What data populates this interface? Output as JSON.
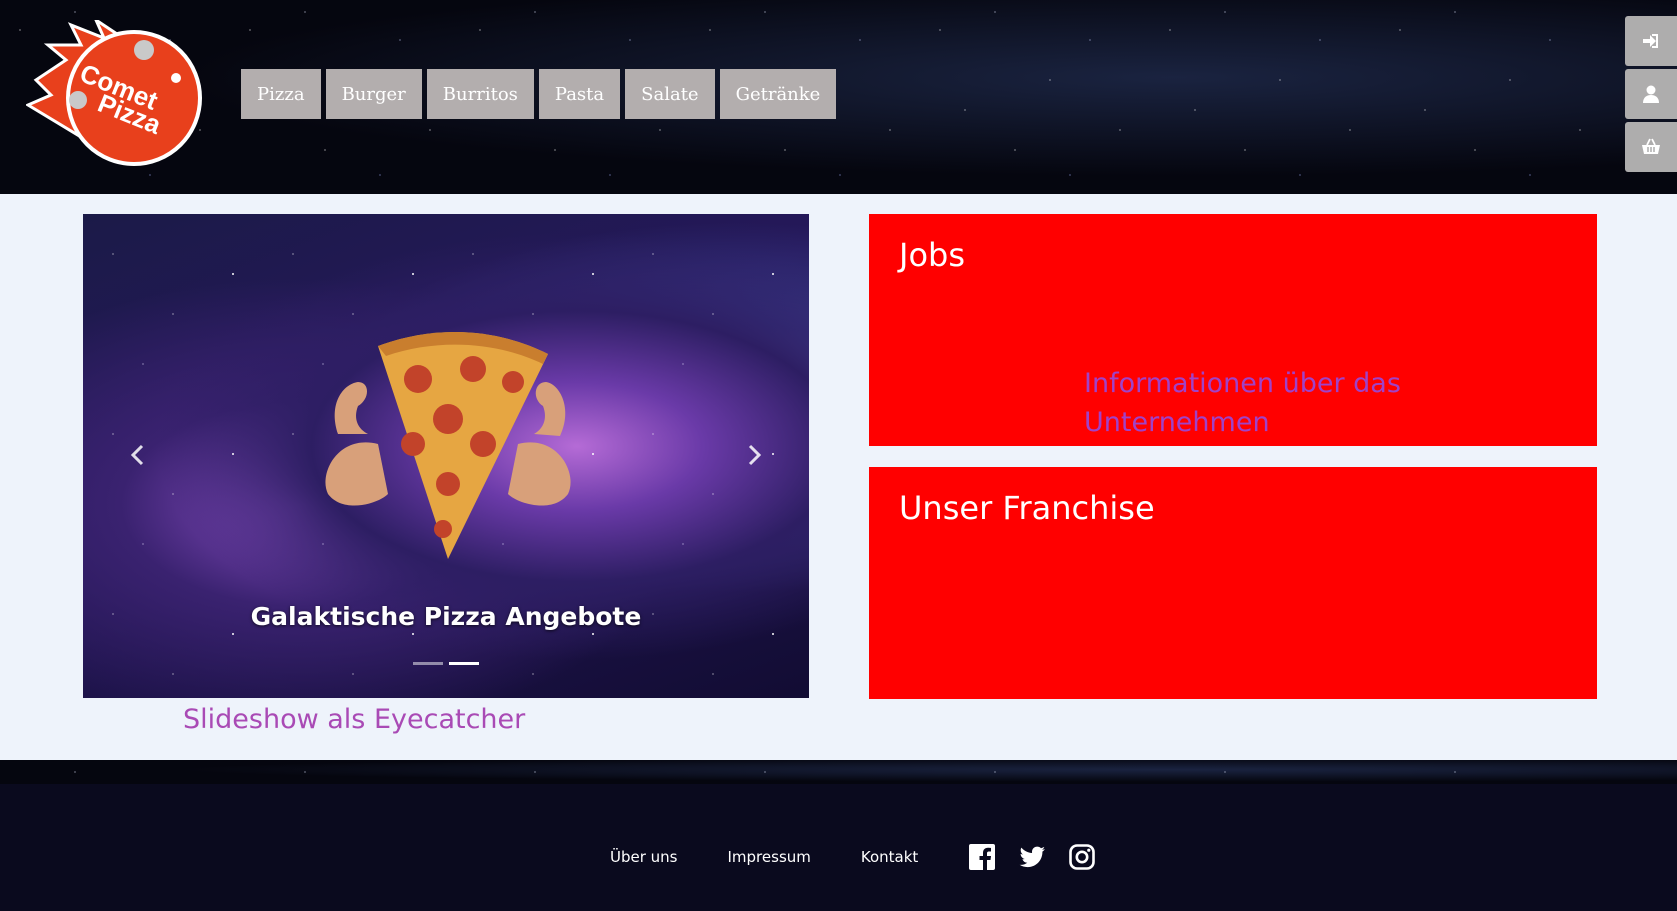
{
  "header": {
    "logo": {
      "line1": "Comet",
      "line2": "Pizza"
    },
    "nav": [
      "Pizza",
      "Burger",
      "Burritos",
      "Pasta",
      "Salate",
      "Getränke"
    ],
    "side_actions": [
      {
        "icon": "login-icon"
      },
      {
        "icon": "user-icon"
      },
      {
        "icon": "basket-icon"
      }
    ]
  },
  "main": {
    "slideshow": {
      "caption": "Galaktische Pizza Angebote",
      "slide_count": 2,
      "active_slide": 2
    },
    "slideshow_note": "Slideshow als Eyecatcher",
    "cards": {
      "jobs": {
        "title": "Jobs",
        "note": "Informationen über das Unternehmen"
      },
      "franchise": {
        "title": "Unser Franchise"
      }
    }
  },
  "footer": {
    "links": [
      "Über uns",
      "Impressum",
      "Kontakt"
    ],
    "social": [
      "facebook-icon",
      "twitter-icon",
      "instagram-icon"
    ]
  },
  "colors": {
    "nav_bg": "#b3aeae",
    "card_red": "#ff0000",
    "note_purple": "#a94ab5",
    "logo_orange": "#e8401c",
    "footer_bg": "#0a0a1e"
  }
}
